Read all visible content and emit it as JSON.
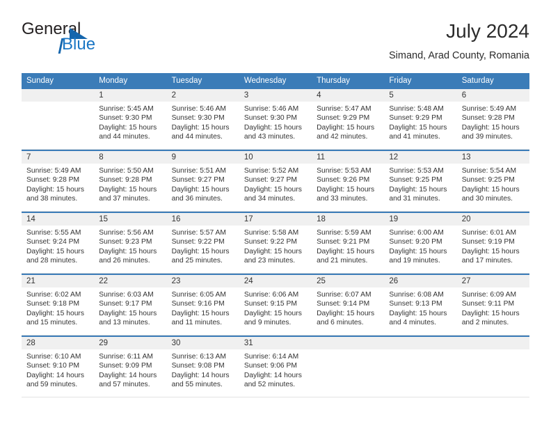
{
  "brand": {
    "word_one": "General",
    "word_two": "Blue",
    "accent_color": "#1a76c4",
    "triangle_icon": "triangle-right-icon"
  },
  "header": {
    "title": "July 2024",
    "subtitle": "Simand, Arad County, Romania"
  },
  "theme": {
    "header_bar": "#3b7cb8",
    "day_number_band": "#f0f0f0",
    "text": "#333333"
  },
  "weekdays": [
    "Sunday",
    "Monday",
    "Tuesday",
    "Wednesday",
    "Thursday",
    "Friday",
    "Saturday"
  ],
  "weeks": [
    [
      {
        "day": "",
        "sunrise": "",
        "sunset": "",
        "daylight_1": "",
        "daylight_2": ""
      },
      {
        "day": "1",
        "sunrise": "Sunrise: 5:45 AM",
        "sunset": "Sunset: 9:30 PM",
        "daylight_1": "Daylight: 15 hours",
        "daylight_2": "and 44 minutes."
      },
      {
        "day": "2",
        "sunrise": "Sunrise: 5:46 AM",
        "sunset": "Sunset: 9:30 PM",
        "daylight_1": "Daylight: 15 hours",
        "daylight_2": "and 44 minutes."
      },
      {
        "day": "3",
        "sunrise": "Sunrise: 5:46 AM",
        "sunset": "Sunset: 9:30 PM",
        "daylight_1": "Daylight: 15 hours",
        "daylight_2": "and 43 minutes."
      },
      {
        "day": "4",
        "sunrise": "Sunrise: 5:47 AM",
        "sunset": "Sunset: 9:29 PM",
        "daylight_1": "Daylight: 15 hours",
        "daylight_2": "and 42 minutes."
      },
      {
        "day": "5",
        "sunrise": "Sunrise: 5:48 AM",
        "sunset": "Sunset: 9:29 PM",
        "daylight_1": "Daylight: 15 hours",
        "daylight_2": "and 41 minutes."
      },
      {
        "day": "6",
        "sunrise": "Sunrise: 5:49 AM",
        "sunset": "Sunset: 9:28 PM",
        "daylight_1": "Daylight: 15 hours",
        "daylight_2": "and 39 minutes."
      }
    ],
    [
      {
        "day": "7",
        "sunrise": "Sunrise: 5:49 AM",
        "sunset": "Sunset: 9:28 PM",
        "daylight_1": "Daylight: 15 hours",
        "daylight_2": "and 38 minutes."
      },
      {
        "day": "8",
        "sunrise": "Sunrise: 5:50 AM",
        "sunset": "Sunset: 9:28 PM",
        "daylight_1": "Daylight: 15 hours",
        "daylight_2": "and 37 minutes."
      },
      {
        "day": "9",
        "sunrise": "Sunrise: 5:51 AM",
        "sunset": "Sunset: 9:27 PM",
        "daylight_1": "Daylight: 15 hours",
        "daylight_2": "and 36 minutes."
      },
      {
        "day": "10",
        "sunrise": "Sunrise: 5:52 AM",
        "sunset": "Sunset: 9:27 PM",
        "daylight_1": "Daylight: 15 hours",
        "daylight_2": "and 34 minutes."
      },
      {
        "day": "11",
        "sunrise": "Sunrise: 5:53 AM",
        "sunset": "Sunset: 9:26 PM",
        "daylight_1": "Daylight: 15 hours",
        "daylight_2": "and 33 minutes."
      },
      {
        "day": "12",
        "sunrise": "Sunrise: 5:53 AM",
        "sunset": "Sunset: 9:25 PM",
        "daylight_1": "Daylight: 15 hours",
        "daylight_2": "and 31 minutes."
      },
      {
        "day": "13",
        "sunrise": "Sunrise: 5:54 AM",
        "sunset": "Sunset: 9:25 PM",
        "daylight_1": "Daylight: 15 hours",
        "daylight_2": "and 30 minutes."
      }
    ],
    [
      {
        "day": "14",
        "sunrise": "Sunrise: 5:55 AM",
        "sunset": "Sunset: 9:24 PM",
        "daylight_1": "Daylight: 15 hours",
        "daylight_2": "and 28 minutes."
      },
      {
        "day": "15",
        "sunrise": "Sunrise: 5:56 AM",
        "sunset": "Sunset: 9:23 PM",
        "daylight_1": "Daylight: 15 hours",
        "daylight_2": "and 26 minutes."
      },
      {
        "day": "16",
        "sunrise": "Sunrise: 5:57 AM",
        "sunset": "Sunset: 9:22 PM",
        "daylight_1": "Daylight: 15 hours",
        "daylight_2": "and 25 minutes."
      },
      {
        "day": "17",
        "sunrise": "Sunrise: 5:58 AM",
        "sunset": "Sunset: 9:22 PM",
        "daylight_1": "Daylight: 15 hours",
        "daylight_2": "and 23 minutes."
      },
      {
        "day": "18",
        "sunrise": "Sunrise: 5:59 AM",
        "sunset": "Sunset: 9:21 PM",
        "daylight_1": "Daylight: 15 hours",
        "daylight_2": "and 21 minutes."
      },
      {
        "day": "19",
        "sunrise": "Sunrise: 6:00 AM",
        "sunset": "Sunset: 9:20 PM",
        "daylight_1": "Daylight: 15 hours",
        "daylight_2": "and 19 minutes."
      },
      {
        "day": "20",
        "sunrise": "Sunrise: 6:01 AM",
        "sunset": "Sunset: 9:19 PM",
        "daylight_1": "Daylight: 15 hours",
        "daylight_2": "and 17 minutes."
      }
    ],
    [
      {
        "day": "21",
        "sunrise": "Sunrise: 6:02 AM",
        "sunset": "Sunset: 9:18 PM",
        "daylight_1": "Daylight: 15 hours",
        "daylight_2": "and 15 minutes."
      },
      {
        "day": "22",
        "sunrise": "Sunrise: 6:03 AM",
        "sunset": "Sunset: 9:17 PM",
        "daylight_1": "Daylight: 15 hours",
        "daylight_2": "and 13 minutes."
      },
      {
        "day": "23",
        "sunrise": "Sunrise: 6:05 AM",
        "sunset": "Sunset: 9:16 PM",
        "daylight_1": "Daylight: 15 hours",
        "daylight_2": "and 11 minutes."
      },
      {
        "day": "24",
        "sunrise": "Sunrise: 6:06 AM",
        "sunset": "Sunset: 9:15 PM",
        "daylight_1": "Daylight: 15 hours",
        "daylight_2": "and 9 minutes."
      },
      {
        "day": "25",
        "sunrise": "Sunrise: 6:07 AM",
        "sunset": "Sunset: 9:14 PM",
        "daylight_1": "Daylight: 15 hours",
        "daylight_2": "and 6 minutes."
      },
      {
        "day": "26",
        "sunrise": "Sunrise: 6:08 AM",
        "sunset": "Sunset: 9:13 PM",
        "daylight_1": "Daylight: 15 hours",
        "daylight_2": "and 4 minutes."
      },
      {
        "day": "27",
        "sunrise": "Sunrise: 6:09 AM",
        "sunset": "Sunset: 9:11 PM",
        "daylight_1": "Daylight: 15 hours",
        "daylight_2": "and 2 minutes."
      }
    ],
    [
      {
        "day": "28",
        "sunrise": "Sunrise: 6:10 AM",
        "sunset": "Sunset: 9:10 PM",
        "daylight_1": "Daylight: 14 hours",
        "daylight_2": "and 59 minutes."
      },
      {
        "day": "29",
        "sunrise": "Sunrise: 6:11 AM",
        "sunset": "Sunset: 9:09 PM",
        "daylight_1": "Daylight: 14 hours",
        "daylight_2": "and 57 minutes."
      },
      {
        "day": "30",
        "sunrise": "Sunrise: 6:13 AM",
        "sunset": "Sunset: 9:08 PM",
        "daylight_1": "Daylight: 14 hours",
        "daylight_2": "and 55 minutes."
      },
      {
        "day": "31",
        "sunrise": "Sunrise: 6:14 AM",
        "sunset": "Sunset: 9:06 PM",
        "daylight_1": "Daylight: 14 hours",
        "daylight_2": "and 52 minutes."
      },
      {
        "day": "",
        "sunrise": "",
        "sunset": "",
        "daylight_1": "",
        "daylight_2": ""
      },
      {
        "day": "",
        "sunrise": "",
        "sunset": "",
        "daylight_1": "",
        "daylight_2": ""
      },
      {
        "day": "",
        "sunrise": "",
        "sunset": "",
        "daylight_1": "",
        "daylight_2": ""
      }
    ]
  ]
}
